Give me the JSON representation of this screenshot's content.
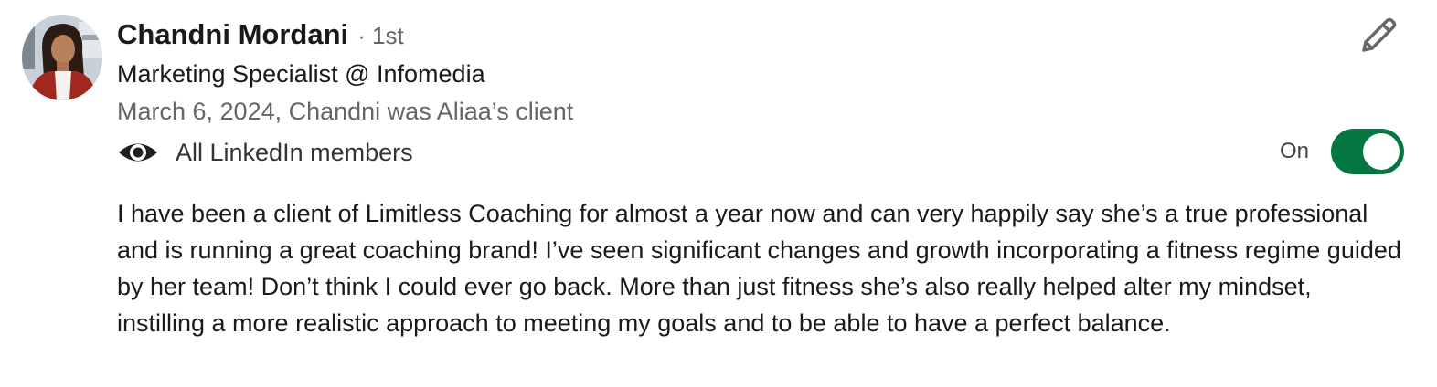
{
  "recommendation": {
    "recommender_name": "Chandni Mordani",
    "connection_degree": "· 1st",
    "headline": "Marketing Specialist @ Infomedia",
    "meta": "March 6, 2024, Chandni was Aliaa’s client",
    "visibility": {
      "icon": "eye-icon",
      "label": "All LinkedIn members"
    },
    "toggle": {
      "label": "On",
      "state": true,
      "color": "#057642"
    },
    "text": "I have been a client of Limitless Coaching for almost a year now and can very happily say she’s a true professional and is running a great coaching brand! I’ve seen significant changes and growth incorporating a fitness regime guided by her team! Don’t think I could ever go back. More than just fitness she’s also really helped alter my mindset, instilling a more realistic approach to meeting my goals and to be able to have a perfect balance.",
    "actions": {
      "edit_icon": "pencil-icon"
    }
  }
}
